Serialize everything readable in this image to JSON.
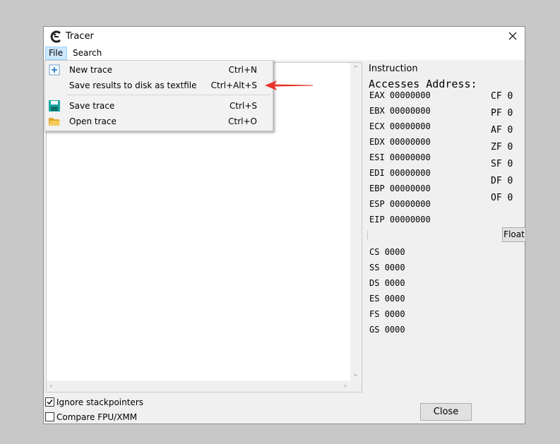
{
  "window": {
    "title": "Tracer"
  },
  "menubar": {
    "file": "File",
    "search": "Search"
  },
  "file_menu": {
    "items": [
      {
        "label": "New trace",
        "shortcut": "Ctrl+N",
        "icon": "new-trace-icon"
      },
      {
        "label": "Save results to disk as textfile",
        "shortcut": "Ctrl+Alt+S",
        "icon": ""
      },
      {
        "label": "Save trace",
        "shortcut": "Ctrl+S",
        "icon": "floppy-disk-icon"
      },
      {
        "label": "Open trace",
        "shortcut": "Ctrl+O",
        "icon": "open-folder-icon"
      }
    ]
  },
  "registers": {
    "heading": "Instruction",
    "subheading": "Accesses Address:",
    "general": [
      {
        "name": "EAX",
        "value": "00000000"
      },
      {
        "name": "EBX",
        "value": "00000000"
      },
      {
        "name": "ECX",
        "value": "00000000"
      },
      {
        "name": "EDX",
        "value": "00000000"
      },
      {
        "name": "ESI",
        "value": "00000000"
      },
      {
        "name": "EDI",
        "value": "00000000"
      },
      {
        "name": "EBP",
        "value": "00000000"
      },
      {
        "name": "ESP",
        "value": "00000000"
      },
      {
        "name": "EIP",
        "value": "00000000"
      }
    ],
    "flags": [
      {
        "name": "CF",
        "value": "0"
      },
      {
        "name": "PF",
        "value": "0"
      },
      {
        "name": "AF",
        "value": "0"
      },
      {
        "name": "ZF",
        "value": "0"
      },
      {
        "name": "SF",
        "value": "0"
      },
      {
        "name": "DF",
        "value": "0"
      },
      {
        "name": "OF",
        "value": "0"
      }
    ],
    "float_button": "Float",
    "segments": [
      {
        "name": "CS",
        "value": "0000"
      },
      {
        "name": "SS",
        "value": "0000"
      },
      {
        "name": "DS",
        "value": "0000"
      },
      {
        "name": "ES",
        "value": "0000"
      },
      {
        "name": "FS",
        "value": "0000"
      },
      {
        "name": "GS",
        "value": "0000"
      }
    ]
  },
  "options": {
    "ignore_stackpointers": {
      "label": "Ignore stackpointers",
      "checked": true
    },
    "compare_fpu": {
      "label": "Compare FPU/XMM",
      "checked": false
    }
  },
  "buttons": {
    "close": "Close"
  },
  "colors": {
    "annotation_arrow": "#e8352b",
    "menu_highlight": "#cce8ff"
  }
}
